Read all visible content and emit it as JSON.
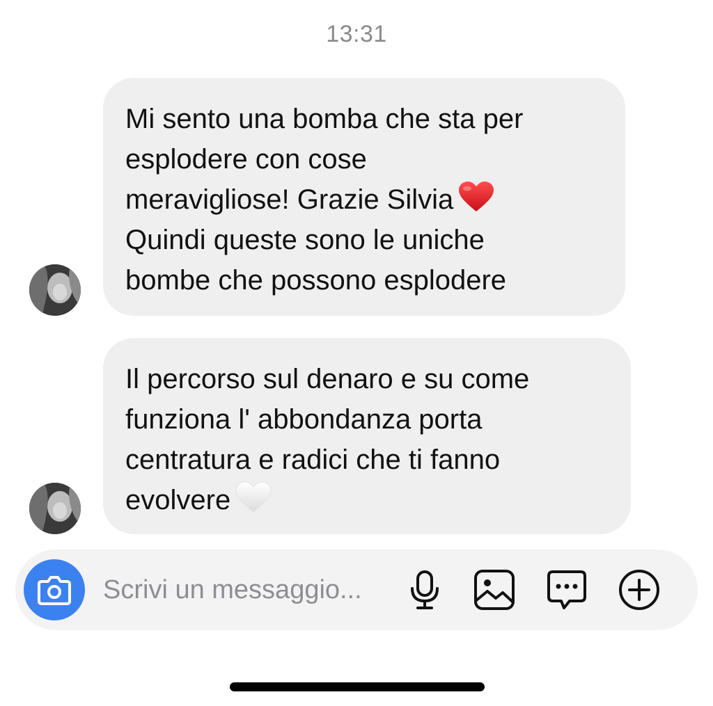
{
  "timestamp": "13:31",
  "messages": [
    {
      "text_before_emoji": "Mi sento una bomba che sta per\nesplodere con cose\nmeravigliose! Grazie Silvia",
      "emoji": "red-heart",
      "text_after_emoji": "Quindi queste sono le uniche\nbombe che possono esplodere"
    },
    {
      "text_before_emoji": "Il percorso sul denaro e su come\nfunziona l' abbondanza porta\ncentratura e radici che ti fanno\nevolvere",
      "emoji": "white-heart",
      "text_after_emoji": ""
    }
  ],
  "composer": {
    "placeholder": "Scrivi un messaggio...",
    "icons": [
      "camera-icon",
      "microphone-icon",
      "image-icon",
      "sticker-chat-icon",
      "plus-circle-icon"
    ],
    "camera_color": "#3b82f0"
  },
  "colors": {
    "bubble": "#efeff0",
    "timestamp": "#8a8a8e"
  }
}
